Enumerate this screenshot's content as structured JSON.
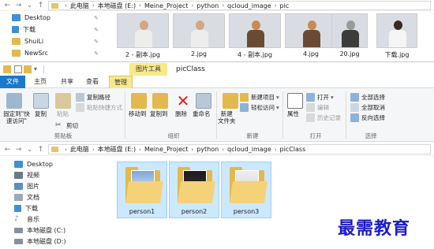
{
  "top_window": {
    "path": [
      "此电脑",
      "本地磁盘 (E:)",
      "Meine_Project",
      "python",
      "qcloud_image",
      "pic"
    ],
    "sidebar": [
      {
        "label": "Desktop",
        "icon": "desktop-icon"
      },
      {
        "label": "下载",
        "icon": "download-icon"
      },
      {
        "label": "ShuiLi",
        "icon": "folder-icon"
      },
      {
        "label": "NewSrc",
        "icon": "folder-icon"
      }
    ],
    "files": [
      {
        "name": "2 - 副本.jpg",
        "style": "sky"
      },
      {
        "name": "2.jpg",
        "style": "sky"
      },
      {
        "name": "4 - 副本.jpg",
        "style": "night"
      },
      {
        "name": "4.jpg",
        "style": "night"
      },
      {
        "name": "20.jpg",
        "style": "gray"
      },
      {
        "name": "下载.jpg",
        "style": "light"
      }
    ]
  },
  "title_bar": {
    "context_tab": "图片工具",
    "title": "picClass"
  },
  "tabs": {
    "file": "文件",
    "home": "主页",
    "share": "共享",
    "view": "查看",
    "manage": "管理"
  },
  "ribbon": {
    "pin_quick_access": "固定到\"快\n速访问\"",
    "copy": "复制",
    "paste": "粘贴",
    "cut": "剪切",
    "copy_path": "复制路径",
    "paste_shortcut": "粘贴快捷方式",
    "clipboard_group": "剪贴板",
    "move_to": "移动到",
    "copy_to": "复制到",
    "delete": "删除",
    "rename": "重命名",
    "organize_group": "组织",
    "new_folder": "新建\n文件夹",
    "new_item": "新建项目",
    "easy_access": "轻松访问",
    "new_group": "新建",
    "properties": "属性",
    "open": "打开",
    "edit": "编辑",
    "history": "历史记录",
    "open_group": "打开",
    "select_all": "全部选择",
    "select_none": "全部取消",
    "invert_selection": "反向选择",
    "select_group": "选择"
  },
  "bottom_window": {
    "path": [
      "此电脑",
      "本地磁盘 (E:)",
      "Meine_Project",
      "python",
      "qcloud_image",
      "picClass"
    ],
    "sidebar": [
      {
        "label": "Desktop",
        "icon": "desktop-icon"
      },
      {
        "label": "视频",
        "icon": "video-icon"
      },
      {
        "label": "图片",
        "icon": "picture-icon"
      },
      {
        "label": "文档",
        "icon": "document-icon"
      },
      {
        "label": "下载",
        "icon": "download-icon"
      },
      {
        "label": "音乐",
        "icon": "music-icon"
      },
      {
        "label": "本地磁盘 (C:)",
        "icon": "drive-icon"
      },
      {
        "label": "本地磁盘 (D:)",
        "icon": "drive-icon"
      }
    ],
    "folders": [
      {
        "name": "person1"
      },
      {
        "name": "person2"
      },
      {
        "name": "person3"
      }
    ]
  },
  "watermark": "最需教育",
  "colors": {
    "file_tab": "#1979ca",
    "context_tab": "#f7e98b",
    "selection": "#cce8ff",
    "folder": "#e3b94f",
    "watermark": "#1c1cc8"
  }
}
